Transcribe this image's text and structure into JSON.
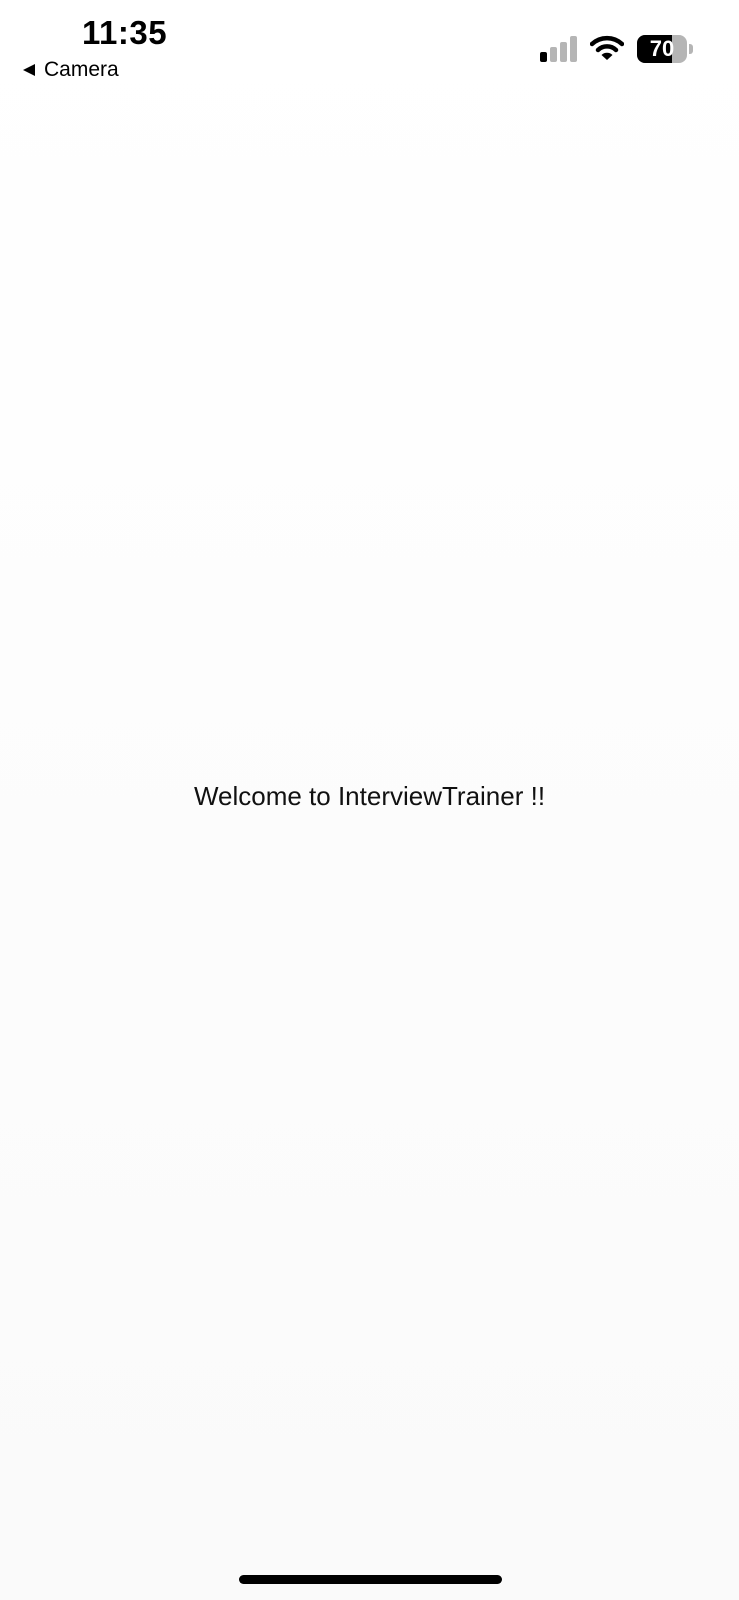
{
  "status_bar": {
    "time": "11:35",
    "back_label": "Camera",
    "signal_bars_active": 1,
    "signal_bars_total": 4,
    "battery_percent": 70,
    "battery_label": "70",
    "icons": [
      "back-arrow-icon",
      "cellular-signal-icon",
      "wifi-icon",
      "battery-icon"
    ]
  },
  "main": {
    "welcome_text": "Welcome to InterviewTrainer !!"
  },
  "colors": {
    "text": "#000000",
    "background": "#ffffff",
    "inactive": "#b5b5b5"
  }
}
